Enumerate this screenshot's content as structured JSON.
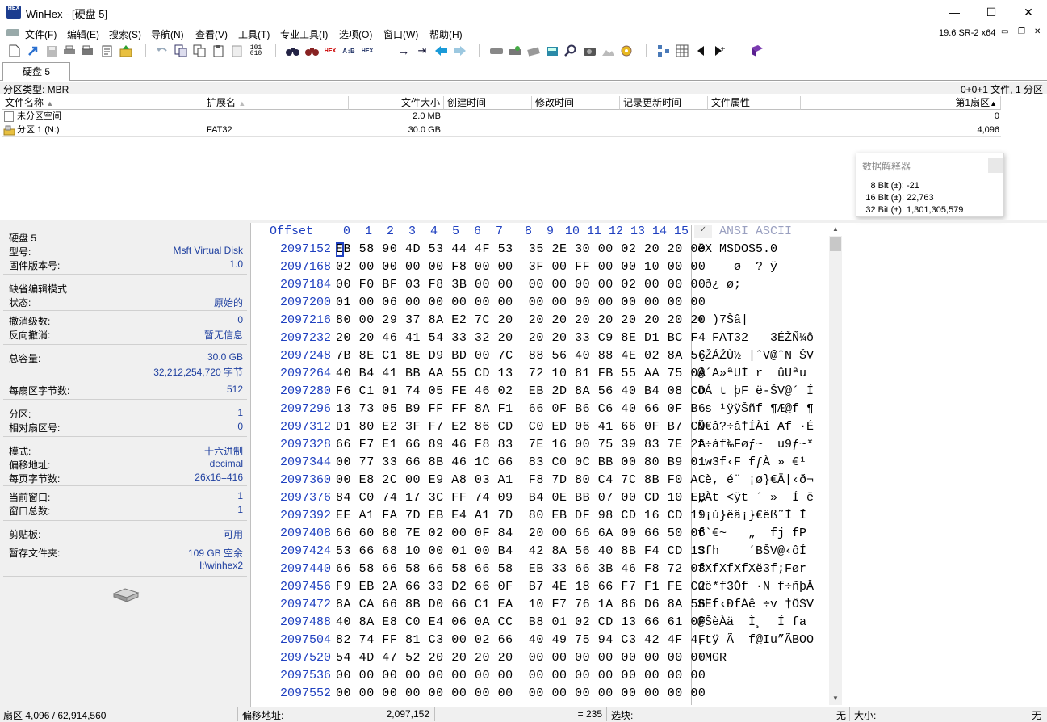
{
  "window": {
    "title": "WinHex - [硬盘 5]",
    "icon_text": "HEX",
    "minimize": "—",
    "maximize": "☐",
    "close": "✕"
  },
  "menu": [
    "文件(F)",
    "编辑(E)",
    "搜索(S)",
    "导航(N)",
    "查看(V)",
    "工具(T)",
    "专业工具(I)",
    "选项(O)",
    "窗口(W)",
    "帮助(H)"
  ],
  "version": "19.6 SR-2 x64",
  "toolbar_icons": [
    "new-file-icon",
    "open-icon",
    "save-icon",
    "print-icon",
    "properties-icon",
    "clipboard-icon",
    "export-icon",
    "undo-icon",
    "copy-block-icon",
    "copy-icon",
    "paste-icon",
    "paste-all-icon",
    "write-icon",
    "binoculars-icon",
    "find-hex-icon",
    "hex-icon",
    "ab-replace-icon",
    "hex-replace-icon",
    "goto-offset-icon",
    "goto-sector-icon",
    "back-icon",
    "forward-icon",
    "open-disk-icon",
    "disk-tools-icon",
    "scanner-icon",
    "calculator-icon",
    "search-icon",
    "camera-icon",
    "image-icon",
    "settings-icon",
    "nodes-icon",
    "grid-icon",
    "prev-icon",
    "next-icon",
    "book-icon"
  ],
  "tab": {
    "label": "硬盘 5"
  },
  "partition_bar": {
    "left": "分区类型: MBR",
    "right": "0+0+1 文件, 1 分区"
  },
  "file_list": {
    "columns": [
      "文件名称",
      "扩展名",
      "文件大小",
      "创建时间",
      "修改时间",
      "记录更新时间",
      "文件属性",
      "第1扇区"
    ],
    "rows": [
      {
        "name": "未分区空间",
        "ext": "",
        "size": "2.0 MB",
        "sector": "0"
      },
      {
        "name": "分区 1 (N:)",
        "ext": "FAT32",
        "size": "30.0 GB",
        "sector": "4,096"
      }
    ]
  },
  "interpreter": {
    "title": "数据解释器",
    "rows": [
      {
        "label": "8 Bit (±):",
        "value": "-21"
      },
      {
        "label": "16 Bit (±):",
        "value": "22,763"
      },
      {
        "label": "32 Bit (±):",
        "value": "1,301,305,579"
      }
    ]
  },
  "info": {
    "disk": "硬盘 5",
    "model_label": "型号:",
    "model": "Msft Virtual Disk",
    "firmware_label": "固件版本号:",
    "firmware": "1.0",
    "edit_mode": "缺省编辑模式",
    "state_label": "状态:",
    "state": "原始的",
    "undo_label": "撤消级数:",
    "undo": "0",
    "redo_label": "反向撤消:",
    "redo": "暂无信息",
    "capacity_label": "总容量:",
    "capacity": "30.0 GB",
    "capacity_bytes": "32,212,254,720 字节",
    "bps_label": "每扇区字节数:",
    "bps": "512",
    "partition_label": "分区:",
    "partition": "1",
    "rel_sector_label": "相对扇区号:",
    "rel_sector": "0",
    "mode_label": "模式:",
    "mode": "十六进制",
    "offset_label": "偏移地址:",
    "offset": "decimal",
    "bpp_label": "每页字节数:",
    "bpp": "26x16=416",
    "cur_win_label": "当前窗口:",
    "cur_win": "1",
    "win_total_label": "窗口总数:",
    "win_total": "1",
    "clipboard_label": "剪贴板:",
    "clipboard": "可用",
    "temp_label": "暂存文件夹:",
    "temp_free": "109 GB 空余",
    "temp_path": "I:\\winhex2"
  },
  "hex": {
    "offset_header": "Offset",
    "col_header": [
      "0",
      "1",
      "2",
      "3",
      "4",
      "5",
      "6",
      "7",
      "8",
      "9",
      "10",
      "11",
      "12",
      "13",
      "14",
      "15"
    ],
    "ascii_header": "ANSI ASCII",
    "rows": [
      {
        "offset": "2097152",
        "bytes": "EB 58 90 4D 53 44 4F 53  35 2E 30 00 02 20 20 00",
        "ascii": "ëX MSDOS5.0"
      },
      {
        "offset": "2097168",
        "bytes": "02 00 00 00 00 F8 00 00  3F 00 FF 00 00 10 00 00",
        "ascii": "     ø  ? ÿ"
      },
      {
        "offset": "2097184",
        "bytes": "00 F0 BF 03 F8 3B 00 00  00 00 00 00 02 00 00 00",
        "ascii": " ð¿ ø;"
      },
      {
        "offset": "2097200",
        "bytes": "01 00 06 00 00 00 00 00  00 00 00 00 00 00 00 00",
        "ascii": ""
      },
      {
        "offset": "2097216",
        "bytes": "80 00 29 37 8A E2 7C 20  20 20 20 20 20 20 20 20",
        "ascii": "€ )7Šâ|"
      },
      {
        "offset": "2097232",
        "bytes": "20 20 46 41 54 33 32 20  20 20 33 C9 8E D1 BC F4",
        "ascii": "  FAT32   3ÉŽÑ¼ô"
      },
      {
        "offset": "2097248",
        "bytes": "7B 8E C1 8E D9 BD 00 7C  88 56 40 88 4E 02 8A 56",
        "ascii": "{ŽÁŽÙ½ |ˆV@ˆN ŠV"
      },
      {
        "offset": "2097264",
        "bytes": "40 B4 41 BB AA 55 CD 13  72 10 81 FB 55 AA 75 0A",
        "ascii": "@´A»ªUÍ r  ûUªu"
      },
      {
        "offset": "2097280",
        "bytes": "F6 C1 01 74 05 FE 46 02  EB 2D 8A 56 40 B4 08 CD",
        "ascii": "öÁ t þF ë-ŠV@´ Í"
      },
      {
        "offset": "2097296",
        "bytes": "13 73 05 B9 FF FF 8A F1  66 0F B6 C6 40 66 0F B6",
        "ascii": " s ¹ÿÿŠñf ¶Æ@f ¶"
      },
      {
        "offset": "2097312",
        "bytes": "D1 80 E2 3F F7 E2 86 CD  C0 ED 06 41 66 0F B7 C9",
        "ascii": "Ñ€â?÷â†ÍÀí Af ·É"
      },
      {
        "offset": "2097328",
        "bytes": "66 F7 E1 66 89 46 F8 83  7E 16 00 75 39 83 7E 2A",
        "ascii": "f÷áf‰Føƒ~  u9ƒ~*"
      },
      {
        "offset": "2097344",
        "bytes": "00 77 33 66 8B 46 1C 66  83 C0 0C BB 00 80 B9 01",
        "ascii": " w3f‹F fƒÀ » €¹"
      },
      {
        "offset": "2097360",
        "bytes": "00 E8 2C 00 E9 A8 03 A1  F8 7D 80 C4 7C 8B F0 AC",
        "ascii": " è, é¨ ¡ø}€Ä|‹ð¬"
      },
      {
        "offset": "2097376",
        "bytes": "84 C0 74 17 3C FF 74 09  B4 0E BB 07 00 CD 10 EB",
        "ascii": "„Àt <ÿt ´ »  Í ë"
      },
      {
        "offset": "2097392",
        "bytes": "EE A1 FA 7D EB E4 A1 7D  80 EB DF 98 CD 16 CD 19",
        "ascii": "î¡ú}ëä¡}€ëß˜Í Í"
      },
      {
        "offset": "2097408",
        "bytes": "66 60 80 7E 02 00 0F 84  20 00 66 6A 00 66 50 06",
        "ascii": "f`€~   „  fj fP"
      },
      {
        "offset": "2097424",
        "bytes": "53 66 68 10 00 01 00 B4  42 8A 56 40 8B F4 CD 13",
        "ascii": "Sfh    ´BŠV@‹ôÍ"
      },
      {
        "offset": "2097440",
        "bytes": "66 58 66 58 66 58 66 58  EB 33 66 3B 46 F8 72 03",
        "ascii": "fXfXfXfXë3f;Før"
      },
      {
        "offset": "2097456",
        "bytes": "F9 EB 2A 66 33 D2 66 0F  B7 4E 18 66 F7 F1 FE C2",
        "ascii": "ùë*f3Òf ·N f÷ñþÂ"
      },
      {
        "offset": "2097472",
        "bytes": "8A CA 66 8B D0 66 C1 EA  10 F7 76 1A 86 D6 8A 56",
        "ascii": "ŠÊf‹ÐfÁê ÷v †ÖŠV"
      },
      {
        "offset": "2097488",
        "bytes": "40 8A E8 C0 E4 06 0A CC  B8 01 02 CD 13 66 61 0F",
        "ascii": "@ŠèÀä  Ì¸  Í fa"
      },
      {
        "offset": "2097504",
        "bytes": "82 74 FF 81 C3 00 02 66  40 49 75 94 C3 42 4F 4F",
        "ascii": "‚tÿ Ã  f@Iu”ÃBOO"
      },
      {
        "offset": "2097520",
        "bytes": "54 4D 47 52 20 20 20 20  00 00 00 00 00 00 00 00",
        "ascii": "TMGR"
      },
      {
        "offset": "2097536",
        "bytes": "00 00 00 00 00 00 00 00  00 00 00 00 00 00 00 00",
        "ascii": ""
      },
      {
        "offset": "2097552",
        "bytes": "00 00 00 00 00 00 00 00  00 00 00 00 00 00 00 00",
        "ascii": ""
      }
    ]
  },
  "status": {
    "sector": "扇区 4,096 / 62,914,560",
    "offset_label": "偏移地址:",
    "offset": "2,097,152",
    "value": "= 235",
    "block_label": "选块:",
    "block": "无",
    "size_label": "大小:",
    "size": "无"
  }
}
